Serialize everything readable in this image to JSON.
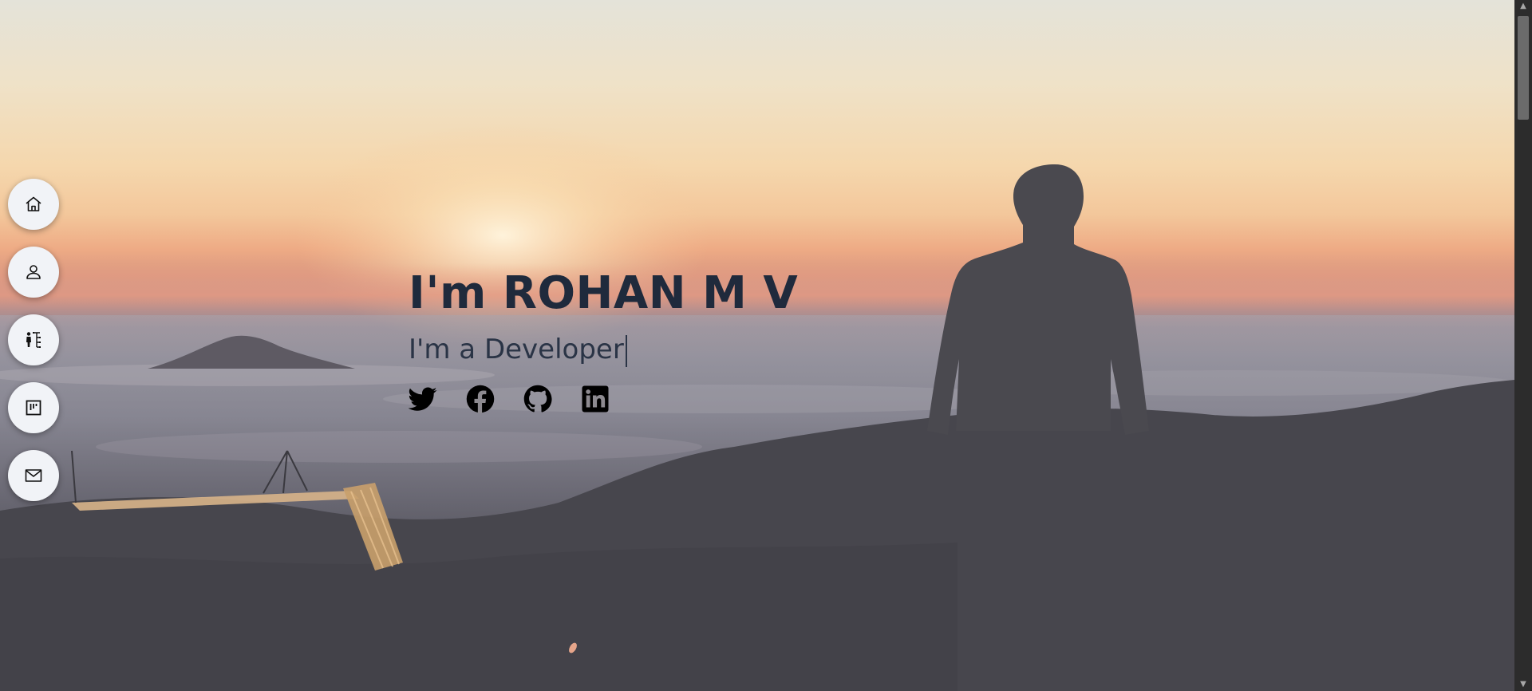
{
  "hero": {
    "title": "I'm ROHAN M V",
    "subtitle": "I'm a Developer"
  },
  "side_nav": {
    "items": [
      {
        "icon": "home-icon"
      },
      {
        "icon": "user-icon"
      },
      {
        "icon": "skills-icon"
      },
      {
        "icon": "portfolio-icon"
      },
      {
        "icon": "mail-icon"
      }
    ]
  },
  "social": {
    "items": [
      {
        "icon": "twitter-icon"
      },
      {
        "icon": "facebook-icon"
      },
      {
        "icon": "github-icon"
      },
      {
        "icon": "linkedin-icon"
      }
    ]
  },
  "colors": {
    "title": "#1f2a3c",
    "nav_button_bg": "#f1f3f7",
    "scrollbar_track": "#2c2c2c",
    "scrollbar_thumb": "#6b6b6b"
  }
}
